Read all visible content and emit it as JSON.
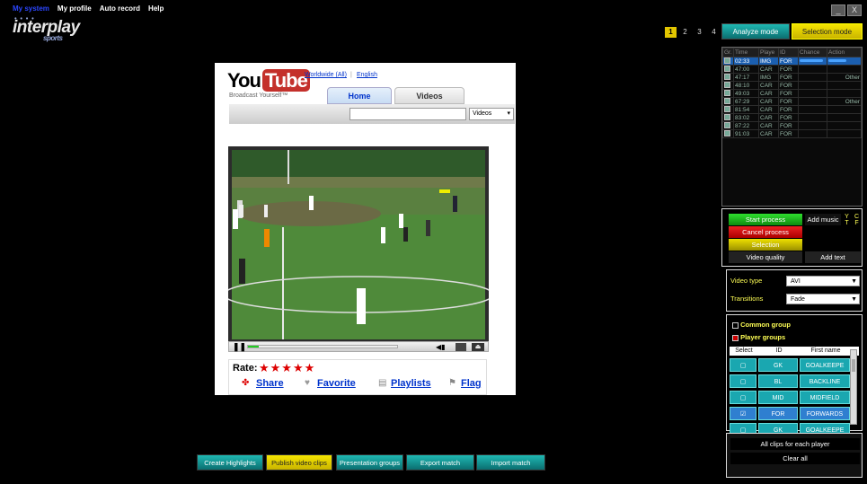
{
  "menu": {
    "items": [
      "My system",
      "My profile",
      "Auto record",
      "Help"
    ]
  },
  "logo": {
    "main": "interplay",
    "sub": "sports"
  },
  "window": {
    "min": "_",
    "close": "X"
  },
  "pager": {
    "pages": [
      "1",
      "2",
      "3",
      "4"
    ],
    "current": "1"
  },
  "modes": {
    "analyze": "Analyze mode",
    "selection": "Selection mode"
  },
  "clips": {
    "headers": [
      "Gr.",
      "Time",
      "Playe",
      "ID",
      "Chance",
      "Action"
    ],
    "rows": [
      {
        "time": "02:33",
        "player": "IMG",
        "id": "FOR",
        "chance": "",
        "action": ""
      },
      {
        "time": "47:00",
        "player": "CAR",
        "id": "FOR",
        "chance": "",
        "action": ""
      },
      {
        "time": "47:17",
        "player": "IMG",
        "id": "FOR",
        "chance": "",
        "action": "Other"
      },
      {
        "time": "48:10",
        "player": "CAR",
        "id": "FOR",
        "chance": "",
        "action": ""
      },
      {
        "time": "49:03",
        "player": "CAR",
        "id": "FOR",
        "chance": "",
        "action": ""
      },
      {
        "time": "67:29",
        "player": "CAR",
        "id": "FOR",
        "chance": "",
        "action": "Other"
      },
      {
        "time": "81:54",
        "player": "CAR",
        "id": "FOR",
        "chance": "",
        "action": ""
      },
      {
        "time": "83:02",
        "player": "CAR",
        "id": "FOR",
        "chance": "",
        "action": ""
      },
      {
        "time": "87:22",
        "player": "CAR",
        "id": "FOR",
        "chance": "",
        "action": ""
      },
      {
        "time": "91:03",
        "player": "CAR",
        "id": "FOR",
        "chance": "",
        "action": ""
      }
    ]
  },
  "process": {
    "start": "Start process",
    "cancel": "Cancel process",
    "selection": "Selection",
    "quality": "Video quality",
    "add_music": "Add music",
    "add_text": "Add text",
    "yt": "Y T",
    "cf": "C F"
  },
  "video": {
    "type_label": "Video type",
    "type_value": "AVI",
    "transitions_label": "Transitions",
    "transitions_value": "Fade"
  },
  "groups": {
    "common": "Common group",
    "player": "Player groups",
    "headers": [
      "Select",
      "ID",
      "First name"
    ],
    "rows": [
      {
        "id": "GK",
        "name": "GOALKEEPE"
      },
      {
        "id": "BL",
        "name": "BACKLINE"
      },
      {
        "id": "MID",
        "name": "MIDFIELD"
      },
      {
        "id": "FOR",
        "name": "FORWARDS"
      },
      {
        "id": "GK",
        "name": "GOALKEEPE"
      }
    ]
  },
  "clips_actions": {
    "all": "All clips for each player",
    "clear": "Clear all"
  },
  "bottom": {
    "create": "Create Highlights",
    "publish": "Publish video clips",
    "presentation": "Presentation groups",
    "export": "Export match",
    "import": "Import match"
  },
  "youtube": {
    "logo_you": "You",
    "logo_tube": "Tube",
    "tagline": "Broadcast Yourself™",
    "region": "Worldwide (All)",
    "language": "English",
    "tab_home": "Home",
    "tab_videos": "Videos",
    "search_select": "Videos",
    "rate": "Rate:",
    "stars": "★★★★★",
    "share": "Share",
    "favorite": "Favorite",
    "playlists": "Playlists",
    "flag": "Flag"
  },
  "colors": {
    "accent_teal": "#1fb9b3",
    "selection_yellow": "#e3c600",
    "start_green": "#1bb51b",
    "cancel_red": "#d11"
  }
}
